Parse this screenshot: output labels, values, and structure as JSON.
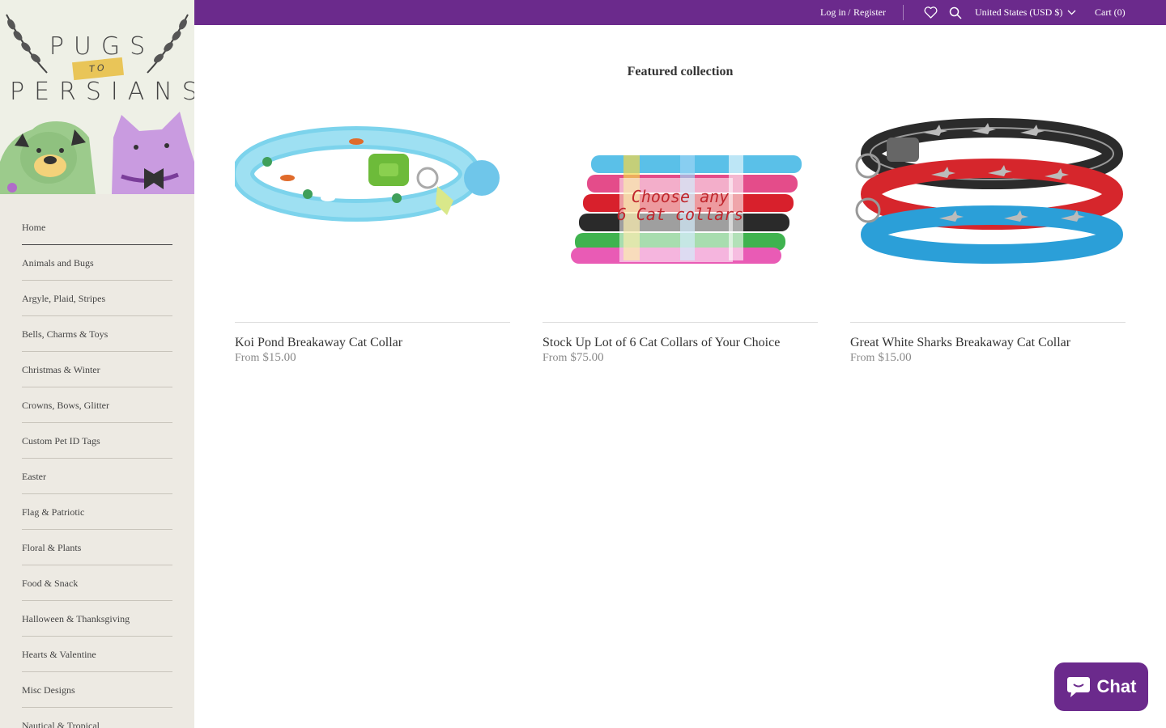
{
  "brand": {
    "line1": "PUGS",
    "ribbon": "TO",
    "line2": "PERSIANS"
  },
  "sidebar": {
    "items": [
      {
        "label": "Home"
      },
      {
        "label": "Animals and Bugs"
      },
      {
        "label": "Argyle, Plaid, Stripes"
      },
      {
        "label": "Bells, Charms & Toys"
      },
      {
        "label": "Christmas & Winter"
      },
      {
        "label": "Crowns, Bows, Glitter"
      },
      {
        "label": "Custom Pet ID Tags"
      },
      {
        "label": "Easter"
      },
      {
        "label": "Flag & Patriotic"
      },
      {
        "label": "Floral & Plants"
      },
      {
        "label": "Food & Snack"
      },
      {
        "label": "Halloween & Thanksgiving"
      },
      {
        "label": "Hearts & Valentine"
      },
      {
        "label": "Misc Designs"
      },
      {
        "label": "Nautical & Tropical"
      }
    ]
  },
  "topbar": {
    "login": "Log in",
    "separator": "/",
    "register": "Register",
    "currency": "United States (USD $)",
    "cart": "Cart (0)",
    "bg_color": "#6b2a8c"
  },
  "main": {
    "section_title": "Featured collection",
    "products": [
      {
        "name": "Koi Pond Breakaway Cat Collar",
        "from": "From",
        "price": "$15.00"
      },
      {
        "name": "Stock Up Lot of 6 Cat Collars of Your Choice",
        "from": "From",
        "price": "$75.00",
        "overlay_line1": "Choose any",
        "overlay_line2": "6 Cat collars"
      },
      {
        "name": "Great White Sharks Breakaway Cat Collar",
        "from": "From",
        "price": "$15.00"
      }
    ]
  },
  "chat": {
    "label": "Chat"
  }
}
